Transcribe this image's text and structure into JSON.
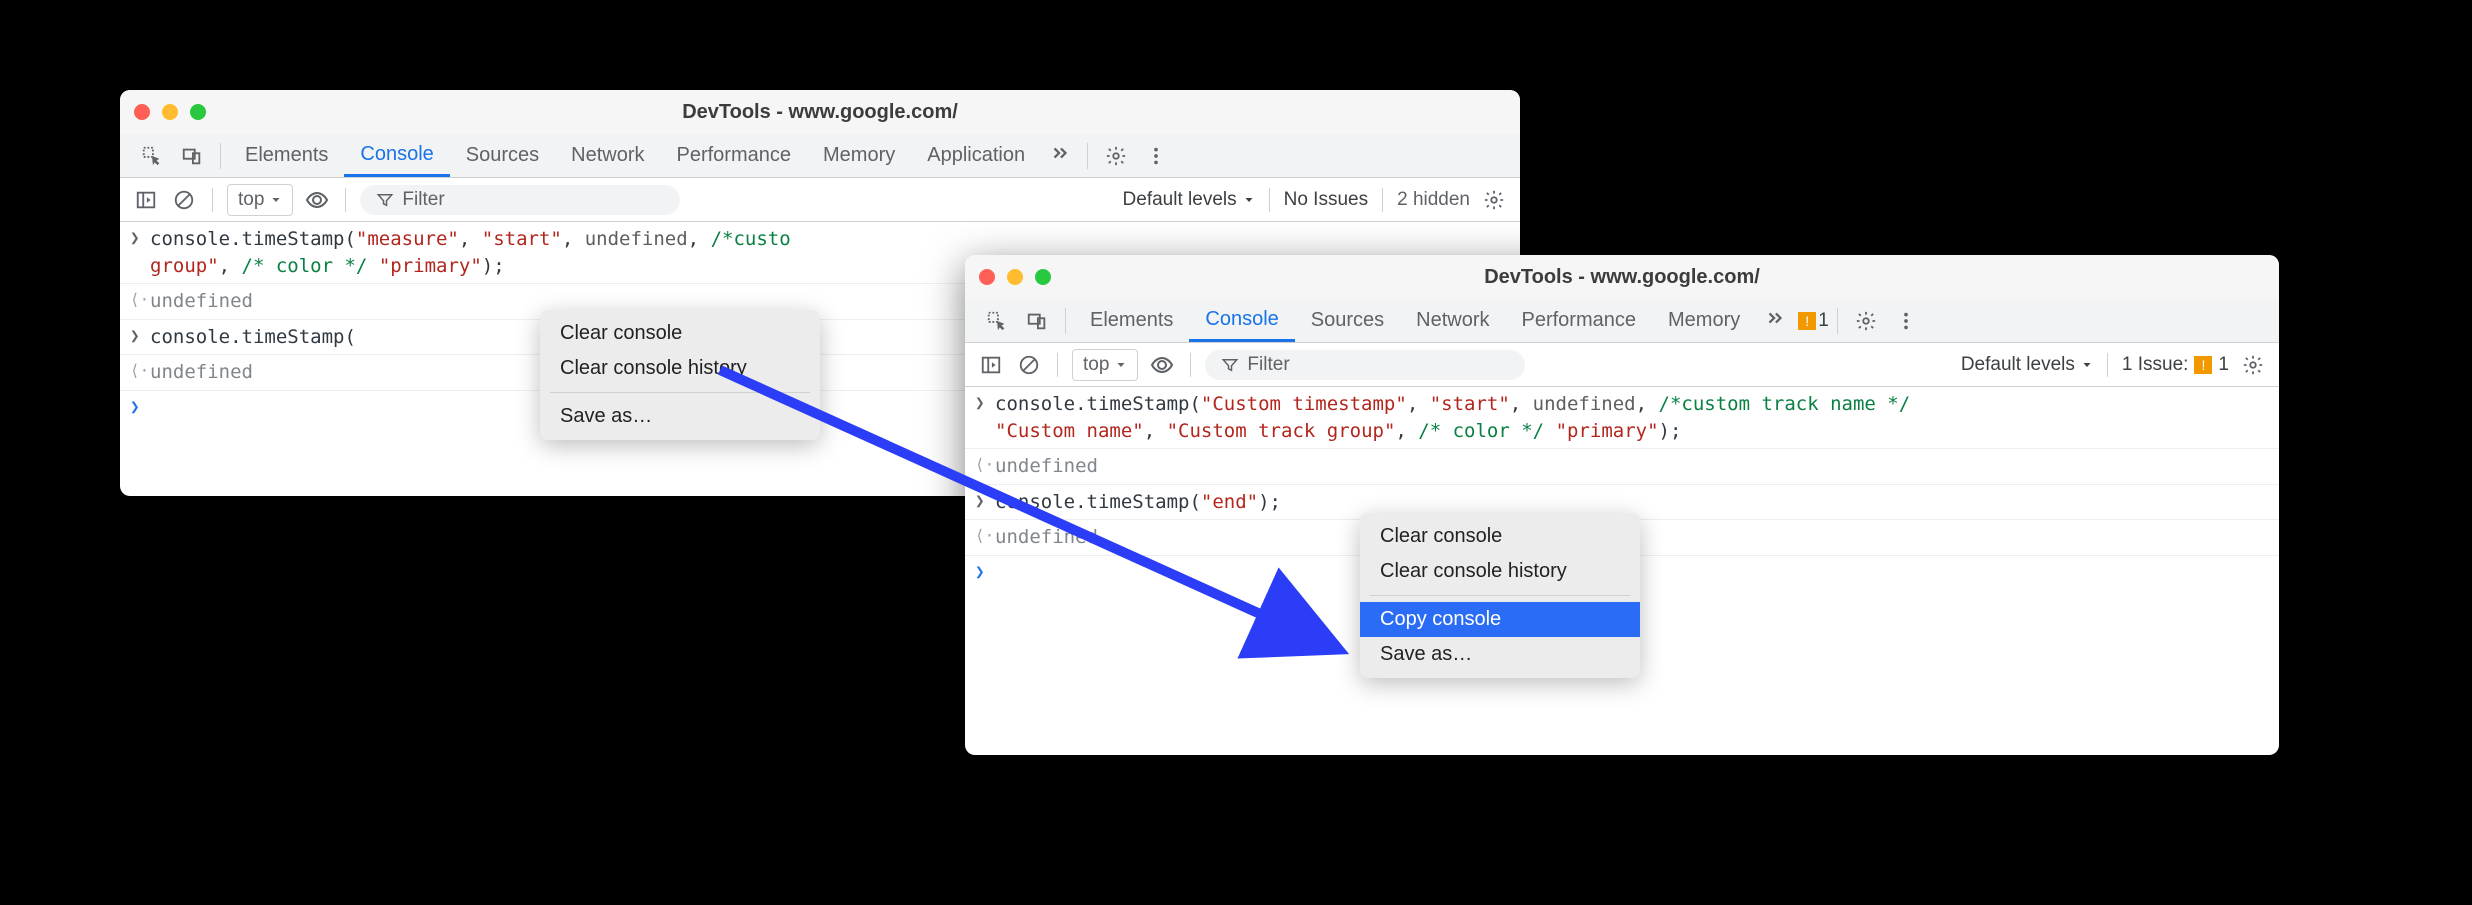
{
  "window_a": {
    "title": "DevTools - www.google.com/",
    "tabs": [
      "Elements",
      "Console",
      "Sources",
      "Network",
      "Performance",
      "Memory",
      "Application"
    ],
    "active_tab": "Console",
    "toolbar": {
      "context": "top",
      "filter_placeholder": "Filter",
      "levels": "Default levels",
      "issues": "No Issues",
      "hidden": "2 hidden"
    },
    "console": {
      "line1_pre": "console.timeStamp(",
      "line1_strings": [
        "\"measure\"",
        "\"start\""
      ],
      "line1_undef": "undefined",
      "line1_comment": "/*custo",
      "line2_pre": "group\"",
      "line2_comment": "/* color */",
      "line2_str": "\"primary\"",
      "line2_close": ");",
      "undefined": "undefined",
      "line3_pre": "console.timeStamp("
    },
    "menu": {
      "clear": "Clear console",
      "history": "Clear console history",
      "saveas": "Save as…"
    }
  },
  "window_b": {
    "title": "DevTools - www.google.com/",
    "tabs": [
      "Elements",
      "Console",
      "Sources",
      "Network",
      "Performance",
      "Memory"
    ],
    "active_tab": "Console",
    "tabstrip_issue_count": "1",
    "toolbar": {
      "context": "top",
      "filter_placeholder": "Filter",
      "levels": "Default levels",
      "issues_label": "1 Issue:",
      "issues_count": "1"
    },
    "console": {
      "line1_pre": "console.timeStamp(",
      "line1_s1": "\"Custom timestamp\"",
      "line1_s2": "\"start\"",
      "line1_undef": "undefined",
      "line1_comment": "/*custom track name */",
      "line2_s1": "\"Custom name\"",
      "line2_s2": "\"Custom track group\"",
      "line2_comment": "/* color */",
      "line2_s3": "\"primary\"",
      "line2_close": ");",
      "undefined": "undefined",
      "line3_pre": "console.timeStamp(",
      "line3_s1": "\"end\"",
      "line3_close": ");"
    },
    "menu": {
      "clear": "Clear console",
      "history": "Clear console history",
      "copy": "Copy console",
      "saveas": "Save as…"
    }
  }
}
